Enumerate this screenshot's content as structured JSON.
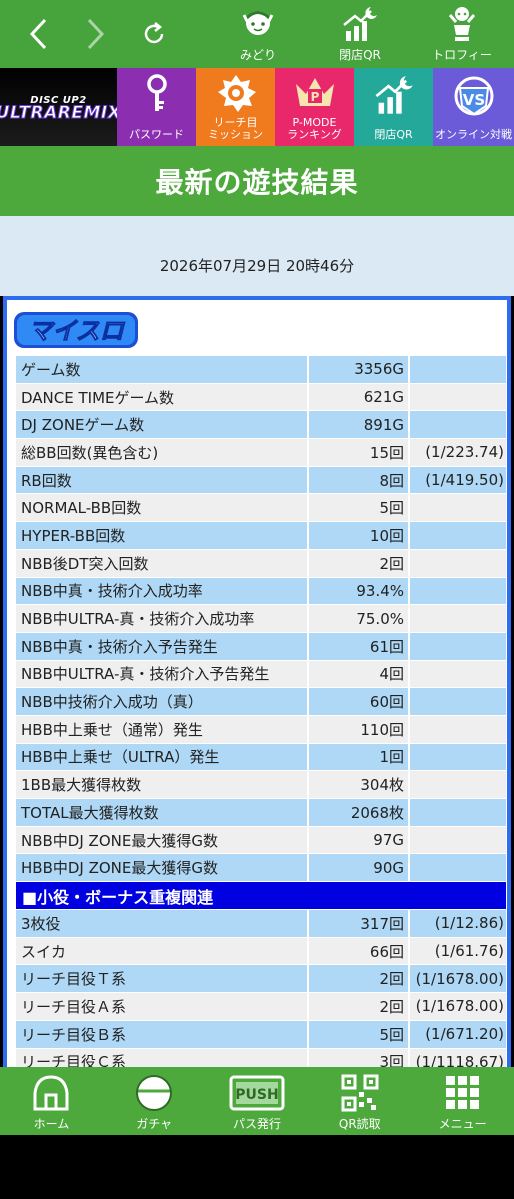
{
  "topnav": {
    "tools": [
      {
        "label": "みどり",
        "icon": "character-icon"
      },
      {
        "label": "閉店QR",
        "icon": "chart-moon-icon"
      },
      {
        "label": "トロフィー",
        "icon": "trophy-figure-icon"
      }
    ]
  },
  "banner": {
    "logo_small": "DISC UP2",
    "logo_big": "ULTRAREMIX",
    "items": [
      {
        "label": "パスワード",
        "color": "#8b2fb0",
        "icon": "key-icon"
      },
      {
        "label": "リーチ目\nミッション",
        "color": "#f07a1e",
        "icon": "badge-icon"
      },
      {
        "label": "P-MODE\nランキング",
        "color": "#e8286a",
        "icon": "crown-icon"
      },
      {
        "label": "閉店QR",
        "color": "#23a89a",
        "icon": "chart-moon-icon"
      },
      {
        "label": "オンライン対戦",
        "color": "#6b5bd8",
        "icon": "vs-shield-icon"
      }
    ]
  },
  "page": {
    "title": "最新の遊技結果",
    "date": "2026年07月29日 20時46分",
    "brand": "マイスロ"
  },
  "results": [
    {
      "label": "ゲーム数",
      "value": "3356G",
      "rate": "",
      "style": "blue"
    },
    {
      "label": "DANCE TIMEゲーム数",
      "value": "621G",
      "rate": "",
      "style": "gray"
    },
    {
      "label": "DJ ZONEゲーム数",
      "value": "891G",
      "rate": "",
      "style": "blue"
    },
    {
      "label": "総BB回数(異色含む)",
      "value": "15回",
      "rate": "(1/223.74)",
      "style": "gray"
    },
    {
      "label": "RB回数",
      "value": "8回",
      "rate": "(1/419.50)",
      "style": "blue"
    },
    {
      "label": "NORMAL-BB回数",
      "value": "5回",
      "rate": "",
      "style": "gray"
    },
    {
      "label": "HYPER-BB回数",
      "value": "10回",
      "rate": "",
      "style": "blue"
    },
    {
      "label": "NBB後DT突入回数",
      "value": "2回",
      "rate": "",
      "style": "gray"
    },
    {
      "label": "NBB中真・技術介入成功率",
      "value": "93.4%",
      "rate": "",
      "style": "blue"
    },
    {
      "label": "NBB中ULTRA-真・技術介入成功率",
      "value": "75.0%",
      "rate": "",
      "style": "gray"
    },
    {
      "label": "NBB中真・技術介入予告発生",
      "value": "61回",
      "rate": "",
      "style": "blue"
    },
    {
      "label": "NBB中ULTRA-真・技術介入予告発生",
      "value": "4回",
      "rate": "",
      "style": "gray"
    },
    {
      "label": "NBB中技術介入成功（真）",
      "value": "60回",
      "rate": "",
      "style": "blue"
    },
    {
      "label": "HBB中上乗せ（通常）発生",
      "value": "110回",
      "rate": "",
      "style": "gray"
    },
    {
      "label": "HBB中上乗せ（ULTRA）発生",
      "value": "1回",
      "rate": "",
      "style": "blue"
    },
    {
      "label": "1BB最大獲得枚数",
      "value": "304枚",
      "rate": "",
      "style": "gray"
    },
    {
      "label": "TOTAL最大獲得枚数",
      "value": "2068枚",
      "rate": "",
      "style": "blue"
    },
    {
      "label": "NBB中DJ ZONE最大獲得G数",
      "value": "97G",
      "rate": "",
      "style": "gray"
    },
    {
      "label": "HBB中DJ ZONE最大獲得G数",
      "value": "90G",
      "rate": "",
      "style": "blue"
    }
  ],
  "section2": {
    "title": "■小役・ボーナス重複関連",
    "rows": [
      {
        "label": "3枚役",
        "value": "317回",
        "rate": "(1/12.86)",
        "style": "blue"
      },
      {
        "label": "スイカ",
        "value": "66回",
        "rate": "(1/61.76)",
        "style": "gray"
      },
      {
        "label": "リーチ目役Ｔ系",
        "value": "2回",
        "rate": "(1/1678.00)",
        "style": "blue"
      },
      {
        "label": "リーチ目役Ａ系",
        "value": "2回",
        "rate": "(1/1678.00)",
        "style": "gray"
      },
      {
        "label": "リーチ目役Ｂ系",
        "value": "5回",
        "rate": "(1/671.20)",
        "style": "blue"
      },
      {
        "label": "リーチ目役Ｃ系",
        "value": "3回",
        "rate": "(1/1118.67)",
        "style": "gray"
      }
    ]
  },
  "bottomnav": [
    {
      "label": "ホーム",
      "icon": "home-icon"
    },
    {
      "label": "ガチャ",
      "icon": "gacha-icon"
    },
    {
      "label": "パス発行",
      "icon": "push-icon"
    },
    {
      "label": "QR読取",
      "icon": "qr-icon"
    },
    {
      "label": "メニュー",
      "icon": "grid-menu-icon"
    }
  ],
  "colors": {
    "green": "#4ea93d",
    "panel_border": "#2f6df0",
    "row_blue": "#aed8f6",
    "row_gray": "#efefef",
    "section_blue": "#0000e0"
  }
}
